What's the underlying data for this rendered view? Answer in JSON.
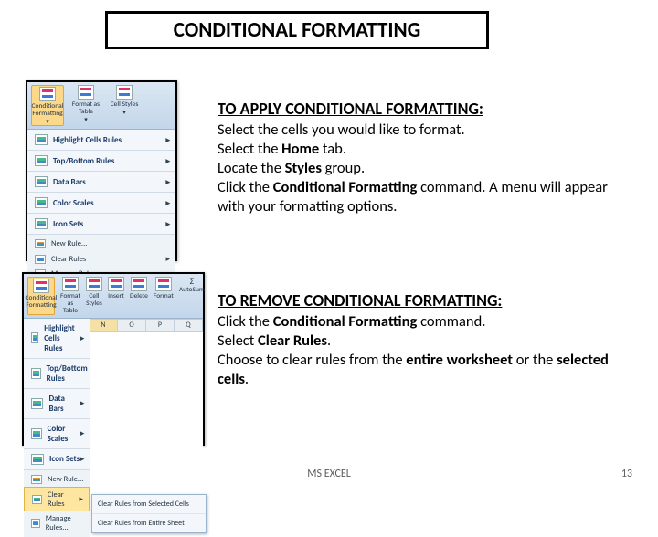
{
  "title": "CONDITIONAL FORMATTING",
  "apply": {
    "heading": "TO APPLY CONDITIONAL FORMATTING:",
    "line1": "Select the cells you would like to format.",
    "line2a": "Select the ",
    "line2b": "Home",
    "line2c": " tab.",
    "line3a": "Locate the ",
    "line3b": "Styles",
    "line3c": " group.",
    "line4a": "Click the ",
    "line4b": "Conditional Formatting",
    "line4c": " command. A menu will appear with your formatting options."
  },
  "remove": {
    "heading": "TO REMOVE CONDITIONAL FORMATTING:",
    "line1a": "Click the ",
    "line1b": "Conditional Formatting",
    "line1c": " command.",
    "line2a": "Select ",
    "line2b": "Clear Rules",
    "line2c": ".",
    "line3a": "Choose to clear rules from the ",
    "line3b": "entire worksheet",
    "line3c": " or the ",
    "line3d": "selected cells",
    "line3e": "."
  },
  "menu": {
    "cf_label": "Conditional Formatting",
    "fmt_table": "Format as Table",
    "cell_styles": "Cell Styles",
    "insert": "Insert",
    "delete": "Delete",
    "format": "Format",
    "autosum": "AutoSum",
    "items": [
      "Highlight Cells Rules",
      "Top/Bottom Rules",
      "Data Bars",
      "Color Scales",
      "Icon Sets"
    ],
    "new_rule": "New Rule...",
    "clear_rules": "Clear Rules",
    "manage_rules": "Manage Rules...",
    "sub": {
      "sel": "Clear Rules from Selected Cells",
      "sheet": "Clear Rules from Entire Sheet"
    },
    "cols": [
      "N",
      "O",
      "P",
      "Q"
    ]
  },
  "footer": {
    "date": "",
    "center": "MS EXCEL",
    "page": "13"
  }
}
